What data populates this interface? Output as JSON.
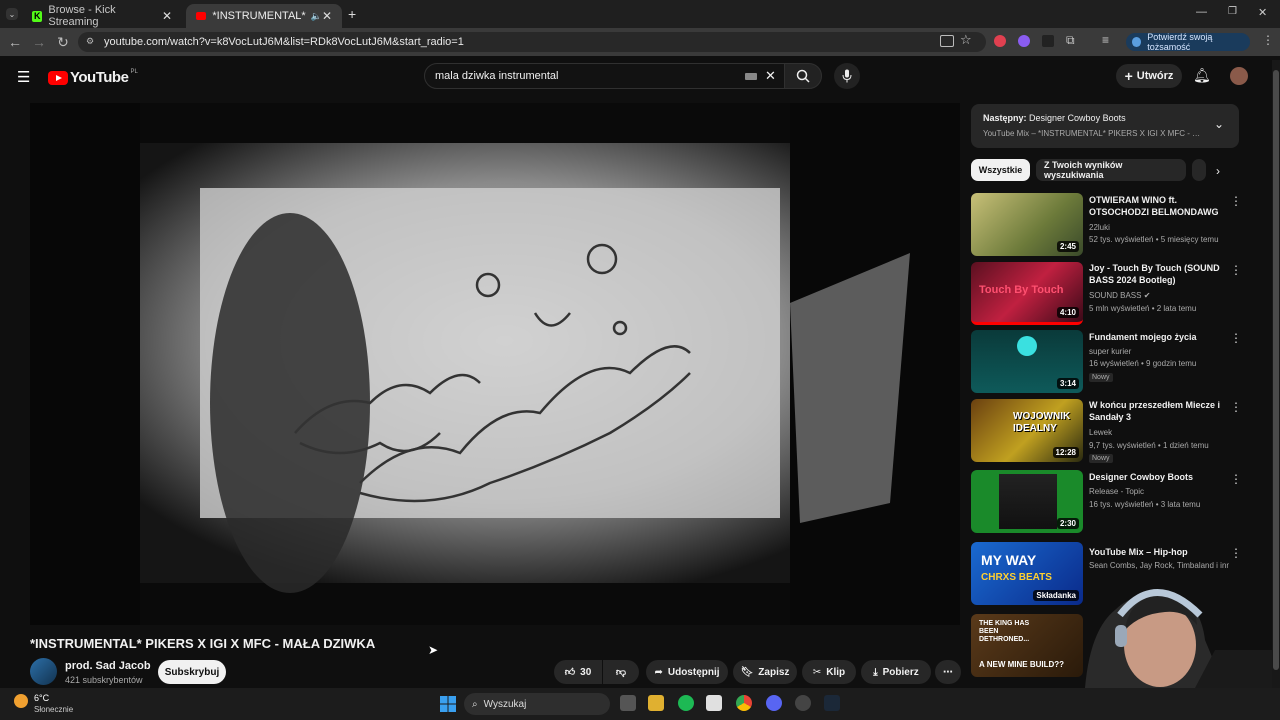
{
  "browser": {
    "tabs": [
      {
        "label": "Browse - Kick Streaming"
      },
      {
        "label": "*INSTRUMENTAL* PIKERS X"
      }
    ],
    "url": "youtube.com/watch?v=k8VocLutJ6M&list=RDk8VocLutJ6M&start_radio=1",
    "verify_label": "Potwierdź swoją tożsamość"
  },
  "header": {
    "logo": "YouTube",
    "region": "PL",
    "search_value": "mala dziwka instrumental",
    "create_label": "Utwórz"
  },
  "video": {
    "title": "*INSTRUMENTAL* PIKERS X IGI X MFC - MAŁA DZIWKA",
    "channel": "prod. Sad Jacob",
    "subscribers": "421 subskrybentów",
    "subscribe_label": "Subskrybuj",
    "likes": "30",
    "share_label": "Udostępnij",
    "save_label": "Zapisz",
    "clip_label": "Klip",
    "download_label": "Pobierz"
  },
  "sidebar": {
    "next_prefix": "Następny:",
    "next_title": "Designer Cowboy Boots",
    "next_sub": "YouTube Mix – *INSTRUMENTAL* PIKERS X IGI X MFC - MAŁA DZIWKA",
    "chips": [
      "Wszystkie",
      "Z Twoich wyników wyszukiwania"
    ],
    "items": [
      {
        "title": "OTWIERAM WINO ft. OTSOCHODZI BELMONDAWG",
        "channel": "22luki",
        "meta": "52 tys. wyświetleń • 5 miesięcy temu",
        "duration": "2:45",
        "badge": ""
      },
      {
        "title": "Joy - Touch By Touch (SOUND BASS 2024 Bootleg)",
        "channel": "SOUND BASS",
        "meta": "5 mln wyświetleń • 2 lata temu",
        "duration": "4:10",
        "badge": ""
      },
      {
        "title": "Fundament mojego życia",
        "channel": "super kurier",
        "meta": "16 wyświetleń • 9 godzin temu",
        "duration": "3:14",
        "badge": "Nowy"
      },
      {
        "title": "W końcu przeszedłem Miecze i Sandały 3",
        "channel": "Lewek",
        "meta": "9,7 tys. wyświetleń • 1 dzień temu",
        "duration": "12:28",
        "badge": "Nowy"
      },
      {
        "title": "Designer Cowboy Boots",
        "channel": "Release - Topic",
        "meta": "16 tys. wyświetleń • 3 lata temu",
        "duration": "2:30",
        "badge": ""
      },
      {
        "title": "YouTube Mix – Hip-hop",
        "channel": "Sean Combs, Jay Rock, Timbaland i inni",
        "meta": "",
        "duration": "Składanka",
        "badge": ""
      }
    ],
    "thumb_texts": {
      "item2": "Touch By Touch",
      "item4": "WOJOWNIK IDEALNY",
      "item6a": "MY WAY",
      "item6b": "CHRXS BEATS",
      "item7a": "THE KING HAS BEEN DETHRONED...",
      "item7b": "A NEW MINE BUILD??"
    }
  },
  "taskbar": {
    "temp": "6°C",
    "weather": "Słonecznie",
    "search_label": "Wyszukaj"
  },
  "colors": {
    "accent": "#ff0000",
    "kick": "#53fc18",
    "background": "#0f0f0f"
  }
}
